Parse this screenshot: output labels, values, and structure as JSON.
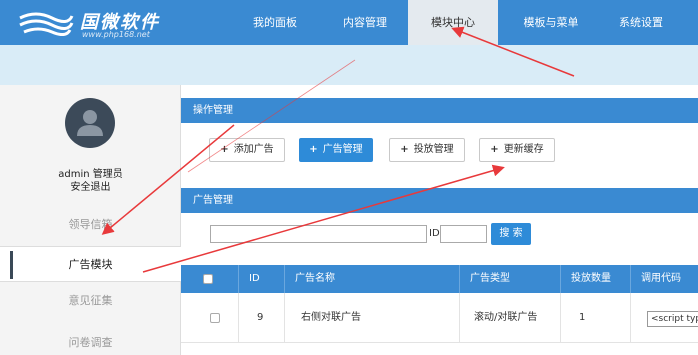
{
  "logo": {
    "name": "国微软件",
    "url": "www.php168.net"
  },
  "nav": [
    {
      "label": "我的面板"
    },
    {
      "label": "内容管理"
    },
    {
      "label": "模块中心",
      "active": true
    },
    {
      "label": "模板与菜单"
    },
    {
      "label": "系统设置"
    }
  ],
  "sidebar": {
    "user": "admin 管理员",
    "logout": "安全退出",
    "items": [
      {
        "label": "领导信箱"
      },
      {
        "label": "广告模块",
        "active": true
      },
      {
        "label": "意见征集"
      },
      {
        "label": "问卷调查"
      }
    ]
  },
  "ops": {
    "title": "操作管理",
    "buttons": [
      {
        "label": "添加广告"
      },
      {
        "label": "广告管理",
        "primary": true
      },
      {
        "label": "投放管理"
      },
      {
        "label": "更新缓存"
      }
    ]
  },
  "ads": {
    "title": "广告管理",
    "search_value": "",
    "id_label": "ID",
    "id_value": "",
    "search_label": "搜 索"
  },
  "table": {
    "headers": [
      "ID",
      "广告名称",
      "广告类型",
      "投放数量",
      "调用代码"
    ],
    "rows": [
      {
        "id": "9",
        "name": "右侧对联广告",
        "type": "滚动/对联广告",
        "count": "1",
        "code": "<script type"
      }
    ]
  },
  "colors": {
    "header": "#3a8ad2",
    "subbar": "#d9ecf7",
    "arrow": "#e8393b"
  }
}
